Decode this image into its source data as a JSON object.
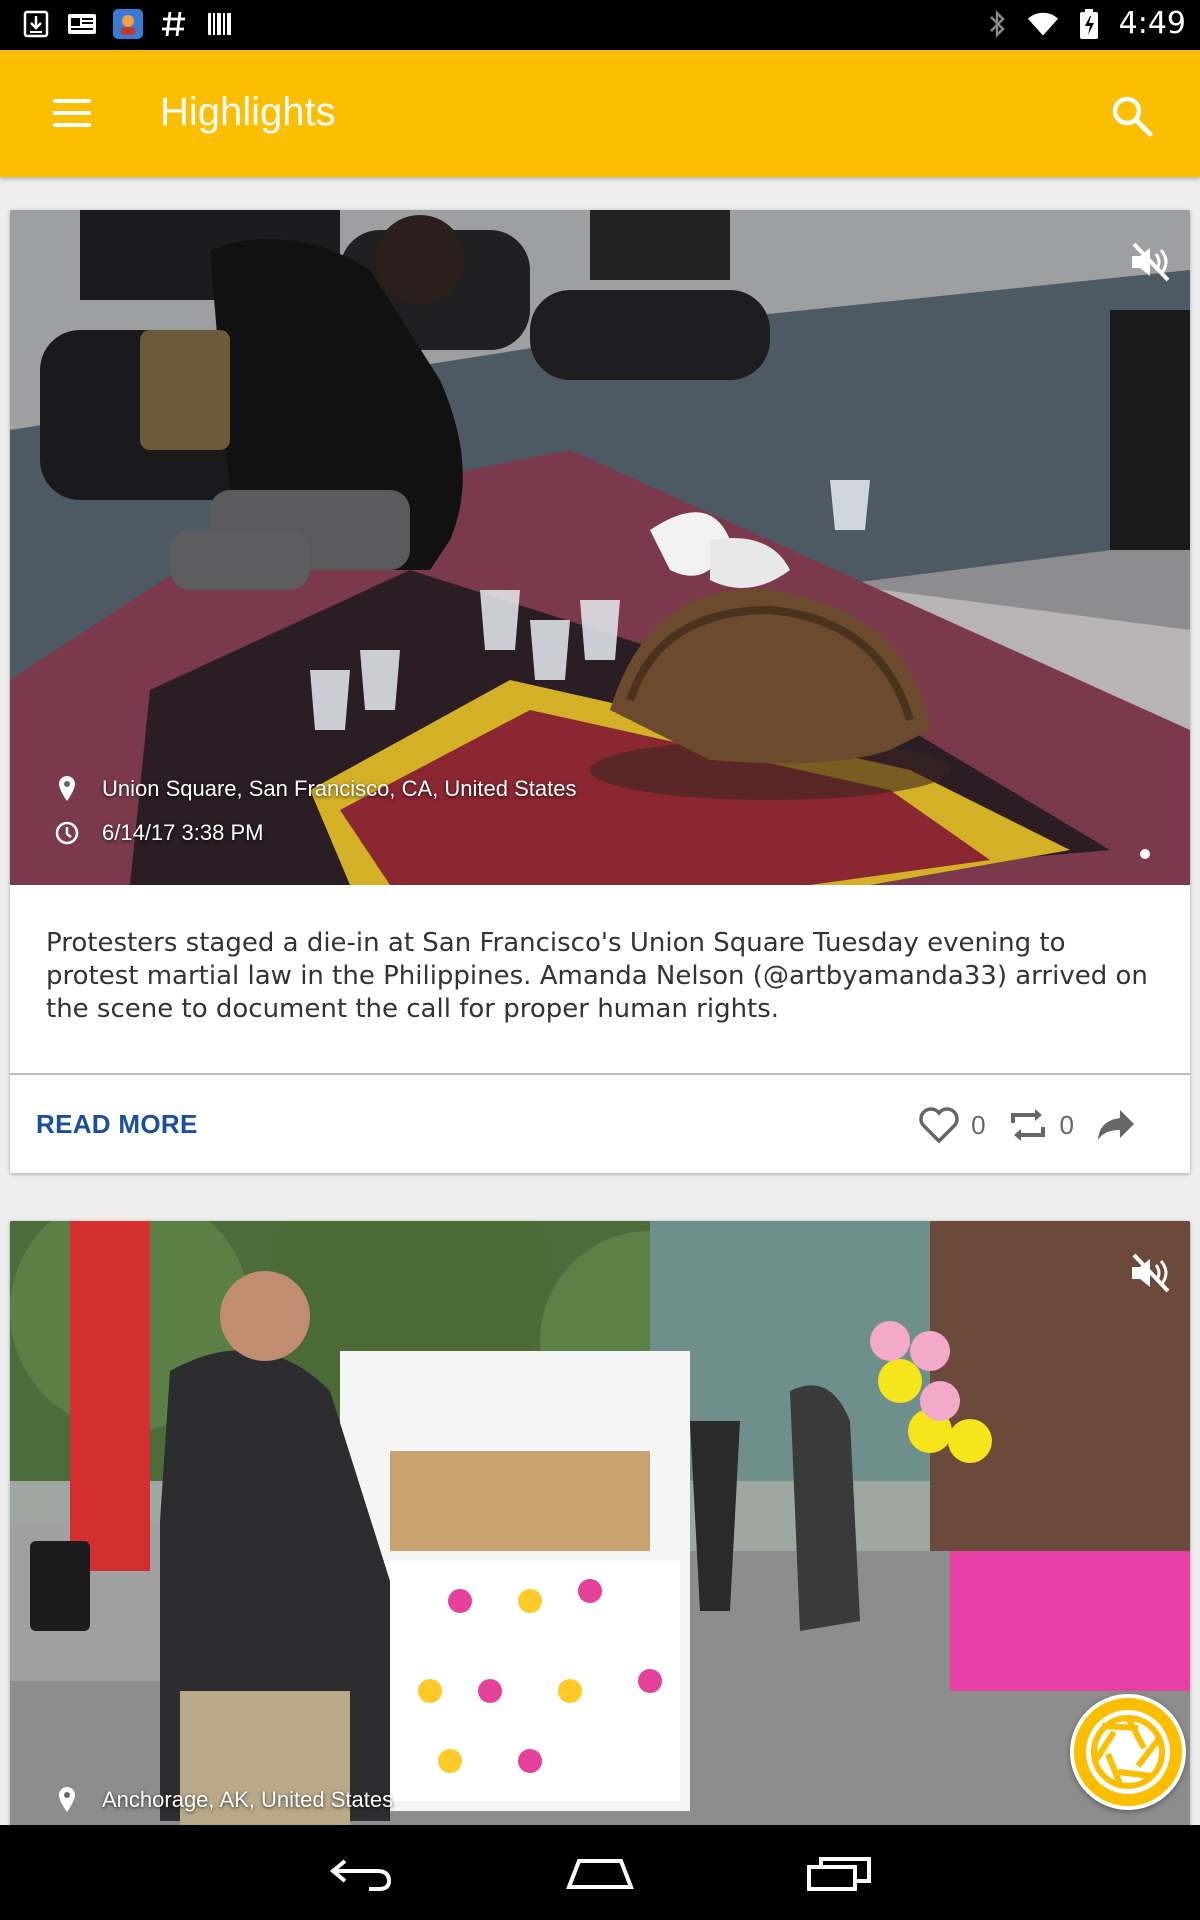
{
  "status_bar": {
    "time": "4:49",
    "left_icons": [
      "download-icon",
      "news-icon",
      "app-icon",
      "hashtag-icon",
      "barcode-icon"
    ],
    "right_icons": [
      "bluetooth-icon",
      "wifi-icon",
      "battery-icon"
    ]
  },
  "app_bar": {
    "title": "Highlights",
    "background": "#fcbe00"
  },
  "posts": [
    {
      "location": "Union Square, San Francisco, CA, United States",
      "timestamp": "6/14/17 3:38 PM",
      "caption": "Protesters staged a die-in at San Francisco's Union Square Tuesday evening to protest martial law in the Philippines. Amanda Nelson (@artbyamanda33) arrived on the scene to document the call for proper human rights.",
      "read_more": "READ MORE",
      "likes": "0",
      "reposts": "0"
    },
    {
      "location": "Anchorage, AK, United States"
    }
  ],
  "colors": {
    "accent": "#fcbe00",
    "link": "#1a4fa0"
  }
}
